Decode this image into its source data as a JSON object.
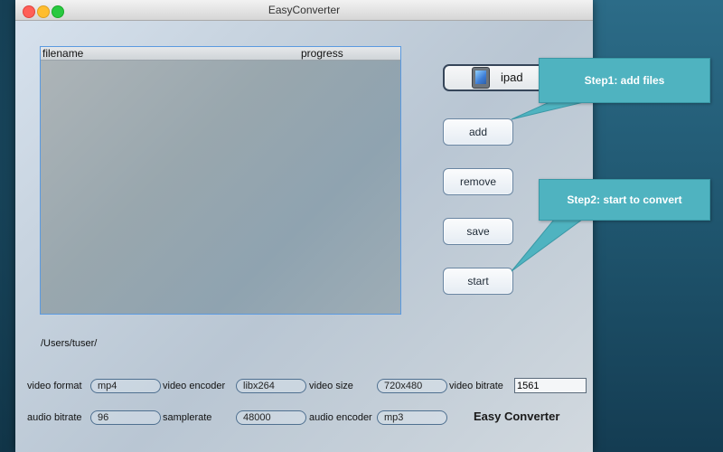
{
  "window": {
    "title": "EasyConverter"
  },
  "file_table": {
    "columns": [
      "filename",
      "progress"
    ],
    "rows": []
  },
  "output_path": "/Users/tuser/",
  "device": {
    "selected": "ipad",
    "icon": "ipad-icon"
  },
  "buttons": {
    "add": "add",
    "remove": "remove",
    "save": "save",
    "start": "start"
  },
  "callouts": {
    "step1": "Step1: add files",
    "step2": "Step2: start to convert",
    "color": "#4fb3c0"
  },
  "settings": {
    "video_format": {
      "label": "video format",
      "value": "mp4"
    },
    "video_encoder": {
      "label": "video encoder",
      "value": "libx264"
    },
    "video_size": {
      "label": "video size",
      "value": "720x480"
    },
    "video_bitrate": {
      "label": "video bitrate",
      "value": "1561"
    },
    "audio_bitrate": {
      "label": "audio bitrate",
      "value": "96"
    },
    "samplerate": {
      "label": "samplerate",
      "value": "48000"
    },
    "audio_encoder": {
      "label": "audio encoder",
      "value": "mp3"
    }
  },
  "brand": "Easy Converter"
}
